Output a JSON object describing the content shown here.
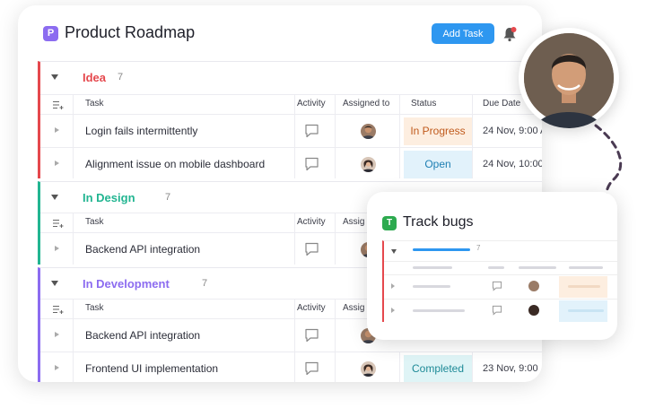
{
  "app": {
    "badge": "P",
    "title": "Product Roadmap",
    "add_task_label": "Add Task"
  },
  "columns": {
    "task": "Task",
    "activity": "Activity",
    "assigned_to": "Assigned to",
    "status": "Status",
    "due_date": "Due Date",
    "assigned_truncated": "Assig"
  },
  "groups": [
    {
      "name": "Idea",
      "count": "7",
      "color": "#e5484d",
      "rows": [
        {
          "task": "Login fails intermittently",
          "status": "In Progress",
          "status_bg": "#fdeee0",
          "status_color": "#c05a1c",
          "due": "24 Nov, 9:00 A"
        },
        {
          "task": "Alignment issue on mobile dashboard",
          "status": "Open",
          "status_bg": "#e2f2fb",
          "status_color": "#1e7fb3",
          "due": "24 Nov, 10:00"
        }
      ]
    },
    {
      "name": "In Design",
      "count": "7",
      "color": "#22b591",
      "rows": [
        {
          "task": "Backend API integration"
        }
      ]
    },
    {
      "name": "In Development",
      "count": "7",
      "color": "#8c6cf0",
      "rows": [
        {
          "task": "Backend API integration"
        },
        {
          "task": "Frontend UI implementation",
          "status": "Completed",
          "status_bg": "#dff4f6",
          "status_color": "#1e8a97",
          "due": "23 Nov, 9:00"
        }
      ]
    }
  ],
  "track_card": {
    "badge": "T",
    "title": "Track bugs",
    "count": "7"
  },
  "icons": [
    "bell-icon",
    "chat-icon",
    "add-row-icon",
    "collapse-arrow-icon",
    "expand-arrow-icon",
    "curved-arrow-icon"
  ],
  "colors": {
    "accent": "#2e97f0",
    "brand": "#8c6cf0",
    "idea": "#e5484d",
    "design": "#22b591",
    "development": "#8c6cf0"
  }
}
